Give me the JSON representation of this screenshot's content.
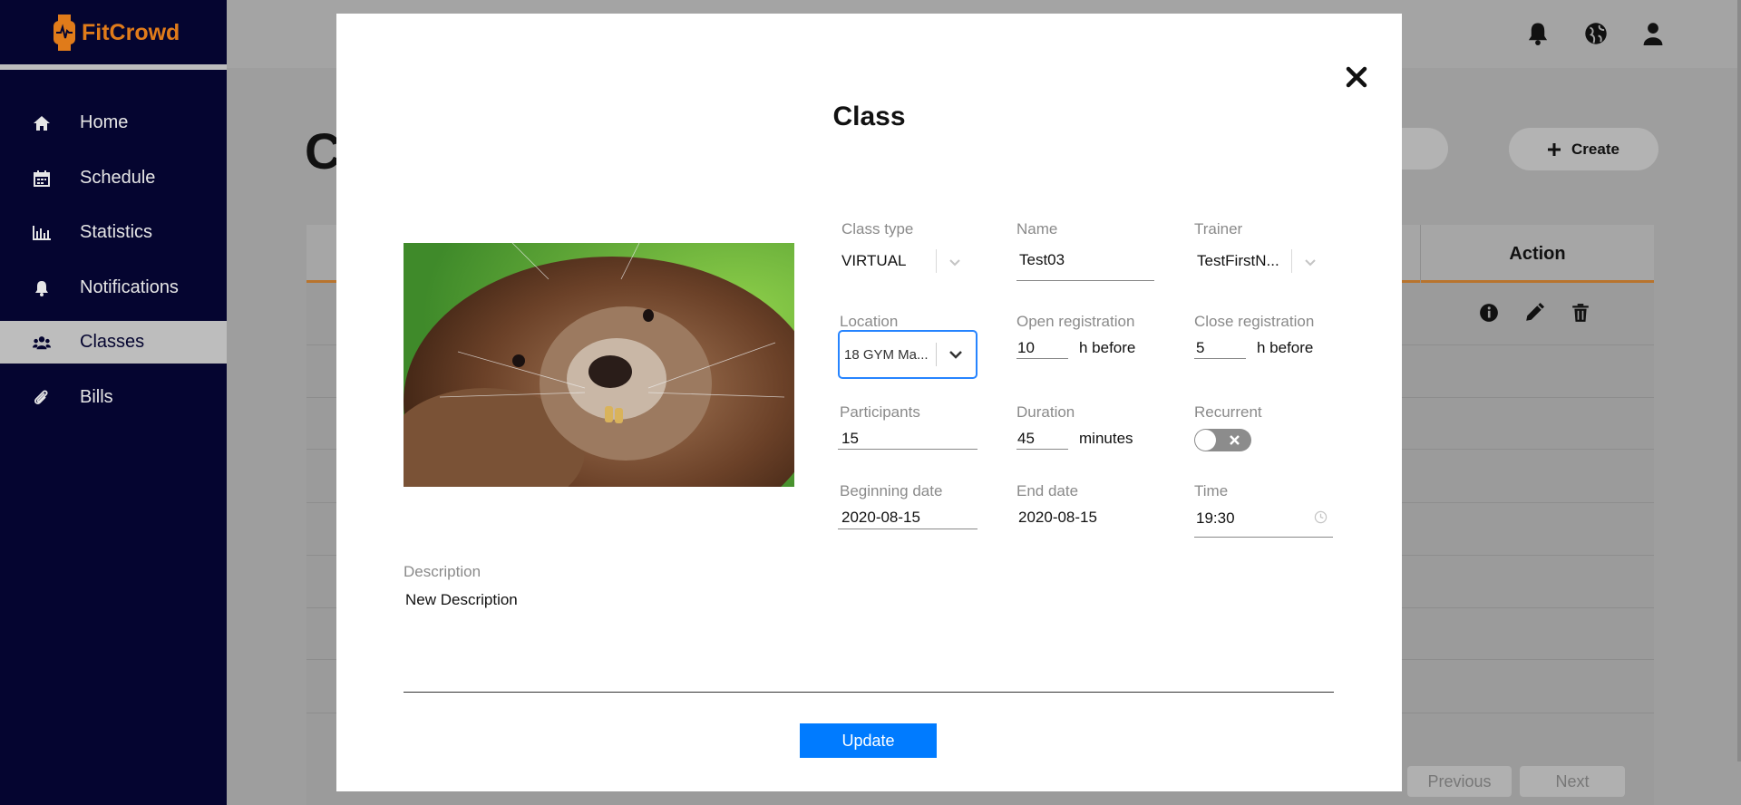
{
  "app": {
    "name": "FitCrowd"
  },
  "sidebar": {
    "items": [
      {
        "label": "Home",
        "icon": "home-icon",
        "active": false
      },
      {
        "label": "Schedule",
        "icon": "calendar-icon",
        "active": false
      },
      {
        "label": "Statistics",
        "icon": "bar-chart-icon",
        "active": false
      },
      {
        "label": "Notifications",
        "icon": "bell-icon",
        "active": false
      },
      {
        "label": "Classes",
        "icon": "users-icon",
        "active": true
      },
      {
        "label": "Bills",
        "icon": "paperclip-icon",
        "active": false
      }
    ]
  },
  "topbar": {
    "icons": [
      "bell-icon",
      "globe-icon",
      "user-icon"
    ]
  },
  "page": {
    "heading_partial": "C",
    "create_label": "Create",
    "table": {
      "action_header": "Action"
    },
    "pagination": {
      "previous": "Previous",
      "next": "Next"
    }
  },
  "modal": {
    "title": "Class",
    "fields": {
      "class_type": {
        "label": "Class type",
        "value": "VIRTUAL"
      },
      "name": {
        "label": "Name",
        "value": "Test03"
      },
      "trainer": {
        "label": "Trainer",
        "value": "TestFirstN..."
      },
      "location": {
        "label": "Location",
        "value": "18 GYM Ma..."
      },
      "open_registration": {
        "label": "Open registration",
        "value": "10",
        "suffix": "h before"
      },
      "close_registration": {
        "label": "Close registration",
        "value": "5",
        "suffix": "h before"
      },
      "participants": {
        "label": "Participants",
        "value": "15"
      },
      "duration": {
        "label": "Duration",
        "value": "45",
        "suffix": "minutes"
      },
      "recurrent": {
        "label": "Recurrent",
        "on": false
      },
      "beginning_date": {
        "label": "Beginning date",
        "value": "2020-08-15"
      },
      "end_date": {
        "label": "End date",
        "value": "2020-08-15"
      },
      "time": {
        "label": "Time",
        "value": "19:30"
      },
      "description": {
        "label": "Description",
        "value": "New Description"
      }
    },
    "update_label": "Update"
  },
  "colors": {
    "brand": "#e07b1a",
    "sidebar_bg": "#050530",
    "primary": "#007bff",
    "focus": "#2684ff"
  }
}
